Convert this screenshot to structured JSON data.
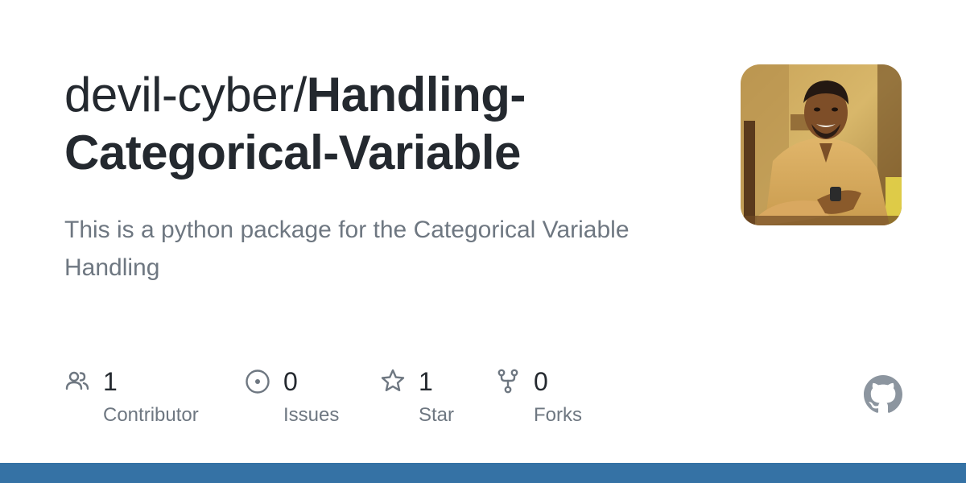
{
  "repo": {
    "owner": "devil-cyber/",
    "name": "Handling-Categorical-Variable",
    "description": "This is a python package for the Categorical Variable Handling"
  },
  "stats": {
    "contributors": {
      "value": "1",
      "label": "Contributor",
      "icon": "people-icon"
    },
    "issues": {
      "value": "0",
      "label": "Issues",
      "icon": "issue-opened-icon"
    },
    "stars": {
      "value": "1",
      "label": "Star",
      "icon": "star-icon"
    },
    "forks": {
      "value": "0",
      "label": "Forks",
      "icon": "repo-forked-icon"
    }
  },
  "avatar": {
    "icon": "owner-avatar"
  },
  "logo": {
    "icon": "github-mark-icon"
  },
  "colors": {
    "title": "#24292f",
    "muted": "#6e7781",
    "icon": "#6e7781",
    "bottom_bar": "#3572a5",
    "github_logo": "#8c959f"
  }
}
